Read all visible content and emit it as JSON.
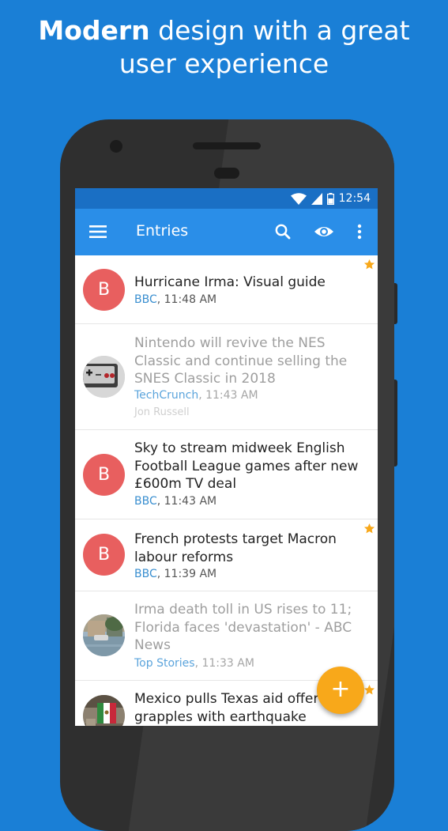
{
  "headline": {
    "bold": "Modern",
    "rest": " design with a great",
    "line2": "user experience"
  },
  "status_bar": {
    "time": "12:54",
    "icons": [
      "wifi-icon",
      "signal-icon",
      "battery-icon"
    ]
  },
  "app_bar": {
    "title": "Entries",
    "actions": [
      "menu-icon",
      "search-icon",
      "eye-icon",
      "more-vert-icon"
    ]
  },
  "colors": {
    "background": "#1a7fd6",
    "app_bar": "#2a8ee8",
    "status_bar": "#1a6fc4",
    "avatar": "#e85f5f",
    "accent": "#f8a81a",
    "source_link": "#3a8fd0"
  },
  "entries": [
    {
      "title": "Hurricane Irma: Visual guide",
      "source": "BBC",
      "time": ", 11:48 AM",
      "avatar_letter": "B",
      "starred": true,
      "read": false
    },
    {
      "title": "Nintendo will revive the NES Classic and continue selling the SNES Classic in 2018",
      "source": "TechCrunch",
      "time": ", 11:43 AM",
      "author": "Jon Russell",
      "avatar_image": "nes-controller",
      "starred": false,
      "read": true
    },
    {
      "title": "Sky to stream midweek English Football League games after new £600m TV deal",
      "source": "BBC",
      "time": ", 11:43 AM",
      "avatar_letter": "B",
      "starred": false,
      "read": false
    },
    {
      "title": "French protests target Macron labour reforms",
      "source": "BBC",
      "time": ", 11:39 AM",
      "avatar_letter": "B",
      "starred": true,
      "read": false
    },
    {
      "title": "Irma death toll in US rises to 11; Florida faces 'devastation' - ABC News",
      "source": "Top Stories",
      "time": ", 11:33 AM",
      "avatar_image": "flooded-street",
      "starred": false,
      "read": true
    },
    {
      "title": "Mexico pulls Texas aid offer as it grapples with earthquake",
      "avatar_image": "mexico-flag",
      "starred": true,
      "read": false
    }
  ],
  "fab": {
    "label": "+"
  }
}
